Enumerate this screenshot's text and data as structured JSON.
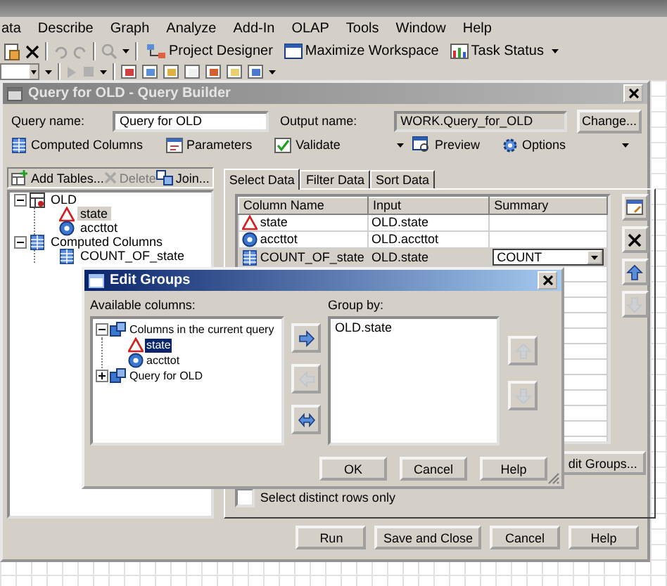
{
  "menu": [
    "ata",
    "Describe",
    "Graph",
    "Analyze",
    "Add-In",
    "OLAP",
    "Tools",
    "Window",
    "Help"
  ],
  "toolbar": [
    {
      "label": "Project Designer"
    },
    {
      "label": "Maximize Workspace"
    },
    {
      "label": "Task Status"
    }
  ],
  "query_builder": {
    "title": "Query for OLD - Query Builder",
    "query_name": {
      "label": "Query name:",
      "value": "Query for OLD"
    },
    "output_name": {
      "label": "Output name:",
      "value": "WORK.Query_for_OLD"
    },
    "change_button": "Change...",
    "actions": [
      {
        "label": "Computed Columns",
        "dropdown": false
      },
      {
        "label": "Parameters",
        "dropdown": false
      },
      {
        "label": "Validate",
        "dropdown": true
      },
      {
        "label": "Preview",
        "dropdown": false
      },
      {
        "label": "Options",
        "dropdown": true
      }
    ],
    "table_tools": [
      {
        "label": "Add Tables...",
        "disabled": false
      },
      {
        "label": "Delete",
        "disabled": true
      },
      {
        "label": "Join...",
        "disabled": false
      }
    ],
    "tree": [
      {
        "label": "OLD",
        "kind": "table",
        "expanded": true,
        "children": [
          {
            "label": "state",
            "kind": "char",
            "selected": true
          },
          {
            "label": "accttot",
            "kind": "numeric",
            "selected": false
          }
        ]
      },
      {
        "label": "Computed Columns",
        "kind": "computed",
        "expanded": true,
        "children": [
          {
            "label": "COUNT_OF_state",
            "kind": "computed",
            "selected": false
          }
        ]
      }
    ],
    "tabs": [
      {
        "label": "Select Data",
        "selected": true
      },
      {
        "label": "Filter Data",
        "selected": false
      },
      {
        "label": "Sort Data",
        "selected": false
      }
    ],
    "columns": [
      "Column Name",
      "Input",
      "Summary"
    ],
    "rows": [
      {
        "name": "state",
        "kind": "char",
        "input": "OLD.state",
        "summary": "",
        "selected": false
      },
      {
        "name": "accttot",
        "kind": "numeric",
        "input": "OLD.accttot",
        "summary": "",
        "selected": false
      },
      {
        "name": "COUNT_OF_state",
        "kind": "computed",
        "input": "OLD.state",
        "summary": "COUNT",
        "selected": true
      }
    ],
    "side_tools": [
      {
        "kind": "properties",
        "disabled": false
      },
      {
        "kind": "delete",
        "disabled": false
      },
      {
        "kind": "up",
        "disabled": false
      },
      {
        "kind": "down",
        "disabled": true
      }
    ],
    "edit_groups_button": "dit Groups...",
    "distinct": {
      "label": "Select distinct rows only",
      "checked": false
    },
    "buttons": [
      "Run",
      "Save and Close",
      "Cancel",
      "Help"
    ]
  },
  "edit_groups": {
    "title": "Edit Groups",
    "available_label": "Available columns:",
    "tree": [
      {
        "label": "Columns in the current query",
        "kind": "query",
        "expanded": true,
        "children": [
          {
            "label": "state",
            "kind": "char",
            "selected": true
          },
          {
            "label": "accttot",
            "kind": "numeric",
            "selected": false
          }
        ]
      },
      {
        "label": "Query for OLD",
        "kind": "query",
        "expanded": false
      }
    ],
    "move_buttons": [
      {
        "kind": "add",
        "disabled": false
      },
      {
        "kind": "remove",
        "disabled": true
      },
      {
        "kind": "swap",
        "disabled": false
      }
    ],
    "group_by_label": "Group by:",
    "group_by": [
      "OLD.state"
    ],
    "order_buttons": [
      {
        "kind": "up",
        "disabled": true
      },
      {
        "kind": "down",
        "disabled": true
      }
    ],
    "buttons": [
      "OK",
      "Cancel",
      "Help"
    ]
  }
}
